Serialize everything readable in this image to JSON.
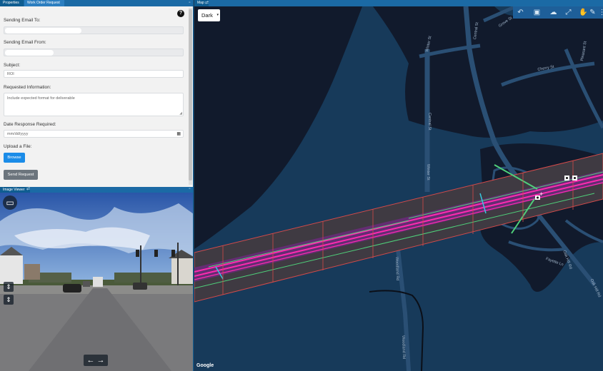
{
  "properties_panel": {
    "tabs": [
      "Properties",
      "Work Order Request"
    ],
    "help_icon": "question-icon",
    "form": {
      "email_to_label": "Sending Email To:",
      "email_from_label": "Sending Email From:",
      "subject_label": "Subject:",
      "subject_value": "ROI",
      "requested_info_label": "Requested Information:",
      "requested_info_placeholder": "Include expected format for deliverable",
      "date_label": "Date Response Required:",
      "date_placeholder": "mm/dd/yyyy",
      "upload_label": "Upload a File:",
      "browse_label": "Browse",
      "send_label": "Send Request"
    },
    "colors": {
      "browse": "#1b8ce8",
      "send": "#6c757d"
    }
  },
  "image_viewer": {
    "title": "Image Viewer",
    "controls": [
      "display-icon",
      "layers-up-icon",
      "layers-down-icon"
    ],
    "nav": {
      "prev": "←",
      "next": "→"
    }
  },
  "map": {
    "title": "Map",
    "basemap_select": "Dark",
    "toolbar": [
      "back-arrow-icon",
      "image-icon",
      "cloud-upload-icon",
      "fullscreen-icon",
      "hand-icon",
      "pencil-icon",
      "more-icon"
    ],
    "streets": [
      "Winter St",
      "Central St",
      "Grove St",
      "Cherry St",
      "Pleasant St",
      "Winter St",
      "Central St",
      "Woodland Rd",
      "Woodland Rd",
      "Oak Hill Rd",
      "Fayette Ln",
      "Oak Hill Rd"
    ],
    "attribution": "Google",
    "colors": {
      "water": "#173a5a",
      "land": "#111a2c",
      "road": "#2a4f74",
      "highlight": "#ff2ab0"
    }
  }
}
